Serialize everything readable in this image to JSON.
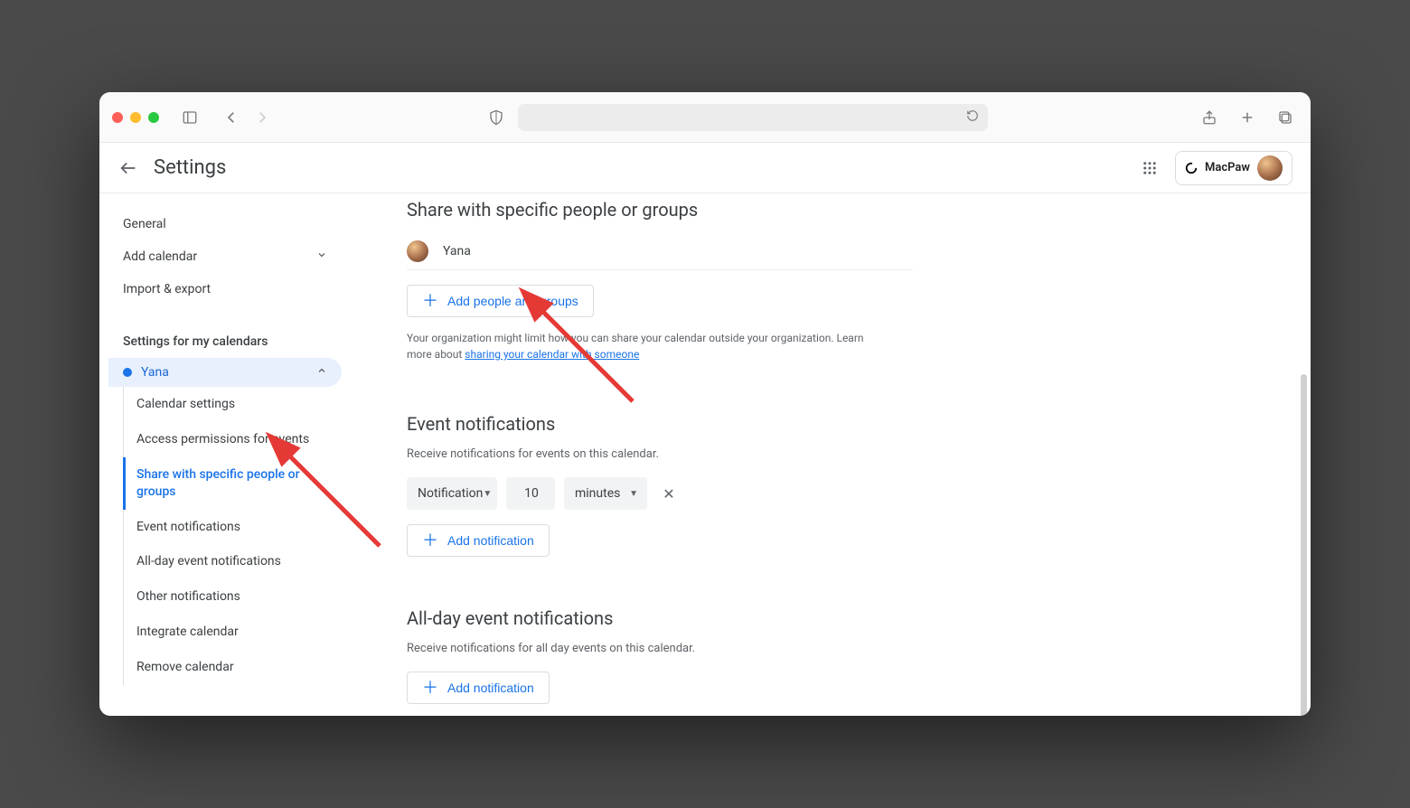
{
  "header": {
    "title": "Settings",
    "org_label": "MacPaw"
  },
  "sidebar": {
    "items_top": [
      {
        "label": "General",
        "has_caret": false
      },
      {
        "label": "Add calendar",
        "has_caret": true
      },
      {
        "label": "Import & export",
        "has_caret": false
      }
    ],
    "section_label": "Settings for my calendars",
    "calendar_name": "Yana",
    "sub_items": [
      "Calendar settings",
      "Access permissions for events",
      "Share with specific people or groups",
      "Event notifications",
      "All-day event notifications",
      "Other notifications",
      "Integrate calendar",
      "Remove calendar"
    ],
    "active_sub_index": 2
  },
  "share": {
    "heading": "Share with specific people or groups",
    "person_name": "Yana",
    "add_button": "Add people and groups",
    "caption_prefix": "Your organization might limit how you can share your calendar outside your organization. Learn more about ",
    "caption_link": "sharing your calendar with someone"
  },
  "event_notifications": {
    "heading": "Event notifications",
    "caption": "Receive notifications for events on this calendar.",
    "method": "Notification",
    "value": "10",
    "unit": "minutes",
    "add_button": "Add notification"
  },
  "allday_notifications": {
    "heading": "All-day event notifications",
    "caption": "Receive notifications for all day events on this calendar.",
    "add_button": "Add notification"
  }
}
